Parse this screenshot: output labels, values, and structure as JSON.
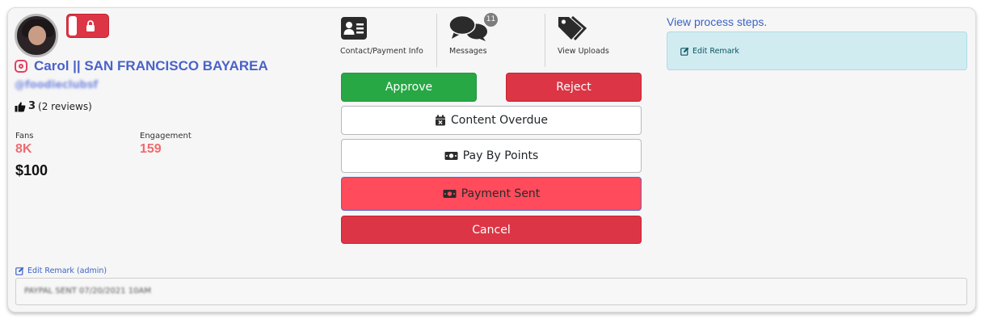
{
  "profile": {
    "name": "Carol || SAN FRANCISCO BAYAREA",
    "handle": "@foodieclubsf",
    "rating_score": "3",
    "rating_reviews": "(2 reviews)"
  },
  "stats": {
    "fans_label": "Fans",
    "fans_value": "8K",
    "engagement_label": "Engagement",
    "engagement_value": "159",
    "price": "$100"
  },
  "tools": {
    "contact_label": "Contact/Payment Info",
    "messages_label": "Messages",
    "messages_badge": "11",
    "uploads_label": "View Uploads"
  },
  "actions": {
    "approve": "Approve",
    "reject": "Reject",
    "content_overdue": "Content Overdue",
    "pay_by_points": "Pay By Points",
    "payment_sent": "Payment Sent",
    "cancel": "Cancel"
  },
  "right": {
    "process_link": "View process steps.",
    "edit_remark": "Edit Remark"
  },
  "admin": {
    "edit_label": "Edit Remark (admin)",
    "remark_value": "PAYPAL SENT 07/20/2021 10AM"
  },
  "colors": {
    "approve": "#28a745",
    "reject": "#dc3545",
    "payment_sent": "#ff4b5c",
    "link": "#3b63c4",
    "stat_value": "#f06a6f",
    "remark_bg": "#d1ecf1"
  }
}
